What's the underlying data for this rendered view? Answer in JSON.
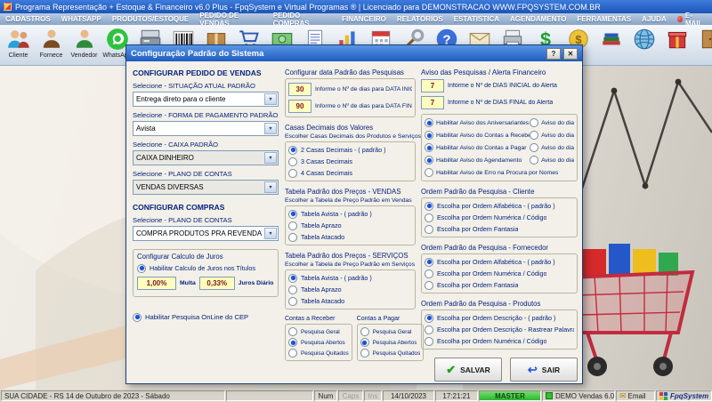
{
  "colors": {
    "accent_blue": "#1b52d8",
    "field_yellow": "#fffdbe",
    "master_green": "#2fb42f",
    "whatsapp_green": "#2ec33e",
    "title_blue": "#1c54b8"
  },
  "icons": {
    "dropdown": "▼",
    "check": "✔",
    "back": "↩",
    "envelope": "✉",
    "help": "?",
    "close": "✕",
    "dollar": "$"
  },
  "titlebar": {
    "title": "Programa Representação + Estoque & Financeiro v6.0 Plus - FpqSystem e Virtual Programas ® | Licenciado para  DEMONSTRACAO WWW.FPQSYSTEM.COM.BR"
  },
  "menubar": {
    "items": [
      "CADASTROS",
      "WHATSAPP",
      "PRODUTOS/ESTOQUE",
      "PEDIDO DE VENDAS",
      "PEDIDO COMPRAS",
      "FINANCEIRO",
      "RELATÓRIOS",
      "ESTATISTICA",
      "AGENDAMENTO",
      "FERRAMENTAS",
      "AJUDA",
      "E-MAIL"
    ]
  },
  "toolbar": {
    "labels": {
      "cliente": "Cliente",
      "fornece": "Fornece",
      "vendedor": "Vendedor",
      "whatsapp": "WhatsApp"
    }
  },
  "dialog": {
    "title": "Configuração Padrão do Sistema",
    "left": {
      "header_vendas": "CONFIGURAR PEDIDO DE VENDAS",
      "situacao_label": "Selecione - SITUAÇÃO ATUAL PADRÃO",
      "situacao_value": "Entrega direto para o cliente",
      "pagamento_label": "Selecione - FORMA DE PAGAMENTO PADRÃO",
      "pagamento_value": "Avista",
      "caixa_label": "Selecione - CAIXA PADRÃO",
      "caixa_value": "CAIXA DINHEIRO",
      "plano_label": "Selecione - PLANO DE CONTAS",
      "plano_value": "VENDAS DIVERSAS",
      "header_compras": "CONFIGURAR COMPRAS",
      "plano_compras_label": "Selecione - PLANO DE CONTAS",
      "plano_compras_value": "COMPRA PRODUTOS PRA REVENDA",
      "juros_group": "Configurar Calculo de Juros",
      "juros_radio": "Habilitar Calculo de Juros nos Títulos",
      "juros_enabled": true,
      "multa_value": "1,00%",
      "multa_label": "Multa",
      "juros_value": "0,33%",
      "juros_label": "Juros Diário",
      "cep_radio": "Habilitar Pesquisa OnLine do CEP",
      "cep_enabled": true
    },
    "middle": {
      "datas_group": "Configurar data Padrão das Pesquisas",
      "data_inicial_value": "30",
      "data_inicial_label": "Informe o Nº de dias para DATA INICIAL",
      "data_final_value": "90",
      "data_final_label": "Informe o Nº de dias para DATA FINAL",
      "casas_title": "Casas Decimais dos Valores",
      "casas_sub": "Escolher Casas Decimais dos Produtos e Serviços",
      "casas_options": [
        "2 Casas Decimais - ( padrão )",
        "3 Casas Decimais",
        "4 Casas Decimais"
      ],
      "casas_selected": [
        true,
        false,
        false
      ],
      "vendas_title": "Tabela Padrão dos Preços - VENDAS",
      "vendas_sub": "Escolher a Tabela de Preço Padrão em Vendas",
      "vendas_options": [
        "Tabela Avista - ( padrão )",
        "Tabela Aprazo",
        "Tabela Atacado"
      ],
      "vendas_selected": [
        true,
        false,
        false
      ],
      "servicos_title": "Tabela Padrão dos Preços - SERVIÇOS",
      "servicos_sub": "Escolher a Tabela de Preço Padrão em Serviços",
      "servicos_options": [
        "Tabela Avista - ( padrão )",
        "Tabela Aprazo",
        "Tabela Atacado"
      ],
      "servicos_selected": [
        true,
        false,
        false
      ],
      "receber_title": "Contas a Receber",
      "receber_options": [
        "Pesquisa Geral",
        "Pesquisa Abertos",
        "Pesquisa Quitados"
      ],
      "receber_selected": [
        false,
        true,
        false
      ],
      "pagar_title": "Contas a Pagar",
      "pagar_options": [
        "Pesquisa Geral",
        "Pesquisa Abertos",
        "Pesquisa Quitados"
      ],
      "pagar_selected": [
        false,
        true,
        false
      ]
    },
    "right": {
      "aviso_title": "Aviso das Pesquisas / Alerta Financeiro",
      "dias_inicial_value": "7",
      "dias_inicial_label": "Informe o Nº de DIAS INICIAL do Alerta",
      "dias_final_value": "7",
      "dias_final_label": "Informe o Nº de DIAS FINAL do Alerta",
      "avisos": [
        "Habilitar Aviso dos Aniversariantes",
        "Habilitar Aviso do Contas a Receber",
        "Habilitar Aviso do Contas a Pagar",
        "Habilitar Aviso do Agendamento",
        "Habilitar Aviso de Erro na Procura por Nomes"
      ],
      "avisos_selected": [
        true,
        true,
        true,
        true,
        false
      ],
      "aviso_dia": "Aviso do dia",
      "aviso_dia_selected": [
        false,
        false,
        false,
        false
      ],
      "cliente_title": "Ordem Padrão da Pesquisa - Cliente",
      "cliente_options": [
        "Escolha por Ordem Alfabética - ( padrão )",
        "Escolha por Ordem Numérica / Código",
        "Escolha por Ordem Fantasia"
      ],
      "cliente_selected": [
        true,
        false,
        false
      ],
      "fornecedor_title": "Ordem Padrão da Pesquisa - Fornecedor",
      "fornecedor_options": [
        "Escolha por Ordem Alfabética - ( padrão )",
        "Escolha por Ordem Numérica / Código",
        "Escolha por Ordem Fantasia"
      ],
      "fornecedor_selected": [
        true,
        false,
        false
      ],
      "produtos_title": "Ordem Padrão da Pesquisa - Produtos",
      "produtos_options": [
        "Escolha por Ordem Descrição - ( padrão )",
        "Escolha por Ordem Descrição - Rastrear Palavra",
        "Escolha por Ordem Numérica / Código"
      ],
      "produtos_selected": [
        true,
        false,
        false
      ],
      "salvar": "SALVAR",
      "sair": "SAIR"
    }
  },
  "statusbar": {
    "location": "SUA CIDADE - RS 14 de Outubro de 2023 - Sábado",
    "num": "Num",
    "caps": "Caps",
    "ins": "Ins",
    "date": "14/10/2023",
    "time": "17:21:21",
    "master": "MASTER",
    "demo": "DEMO Vendas 6.0",
    "email": "Email",
    "brand": "FpqSystem"
  }
}
